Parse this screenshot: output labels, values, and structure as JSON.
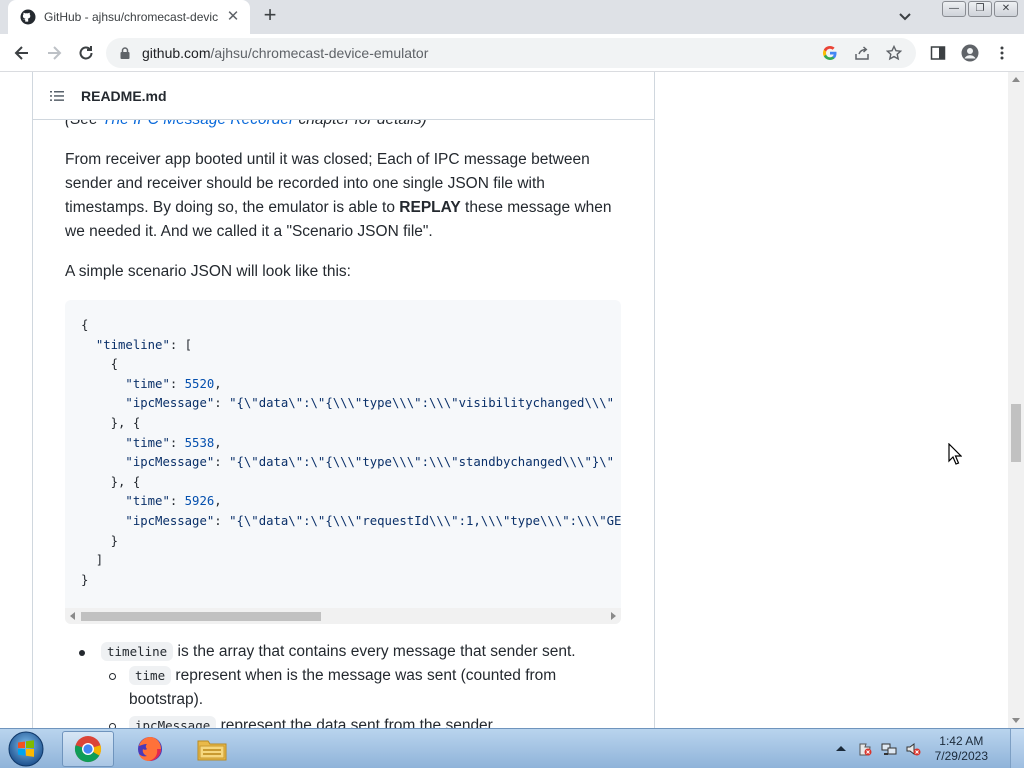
{
  "browser": {
    "tab_title": "GitHub - ajhsu/chromecast-devic",
    "tab_close": "✕",
    "new_tab": "+",
    "url_host": "github.com",
    "url_path": "/ajhsu/chromecast-device-emulator",
    "window_buttons": {
      "minimize": "—",
      "maximize": "❐",
      "close": "✕"
    }
  },
  "readme": {
    "filename": "README.md",
    "cut_prefix": "(See ",
    "cut_link": "The IPC Message Recorder",
    "cut_suffix": " chapter for details)",
    "para1_a": "From receiver app booted until it was closed; Each of IPC message between sender and receiver should be recorded into one single JSON file with timestamps. By doing so, the emulator is able to ",
    "para1_bold": "REPLAY",
    "para1_b": " these message when we needed it. And we called it a \"Scenario JSON file\".",
    "para2": "A simple scenario JSON will look like this:",
    "code": {
      "l1": "{",
      "l2_key": "\"timeline\"",
      "l2_rest": ": [",
      "l3": "    {",
      "l4_key": "\"time\"",
      "l4_num": "5520",
      "l5_key": "\"ipcMessage\"",
      "l5_str": "\"{\\\"data\\\":\\\"{\\\\\\\"type\\\\\\\":\\\\\\\"visibilitychanged\\\\\\\"",
      "l6": "    }, {",
      "l7_key": "\"time\"",
      "l7_num": "5538",
      "l8_key": "\"ipcMessage\"",
      "l8_str": "\"{\\\"data\\\":\\\"{\\\\\\\"type\\\\\\\":\\\\\\\"standbychanged\\\\\\\"}\\\"",
      "l9": "    }, {",
      "l10_key": "\"time\"",
      "l10_num": "5926",
      "l11_key": "\"ipcMessage\"",
      "l11_str": "\"{\\\"data\\\":\\\"{\\\\\\\"requestId\\\\\\\":1,\\\\\\\"type\\\\\\\":\\\\\\\"GE",
      "l12": "    }",
      "l13": "  ]",
      "l14": "}"
    },
    "list": {
      "item1_code": "timeline",
      "item1_text": " is the array that contains every message that sender sent.",
      "sub1_code": "time",
      "sub1_text": " represent when is the message was sent (counted from bootstrap).",
      "sub2_code": "ipcMessage",
      "sub2_text": " represent the data sent from the sender."
    }
  },
  "taskbar": {
    "time": "1:42 AM",
    "date": "7/29/2023"
  }
}
